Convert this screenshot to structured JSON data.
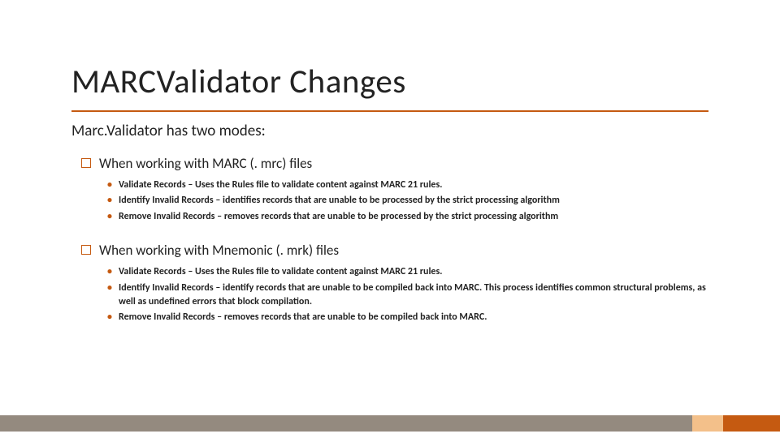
{
  "title": "MARCValidator Changes",
  "lead": "Marc.Validator has two modes:",
  "modes": [
    {
      "title": "When working with MARC (. mrc) files",
      "bullets": [
        "Validate Records – Uses the Rules file to validate content against MARC 21 rules.",
        "Identify Invalid Records – identifies records that are unable to be processed by the strict processing algorithm",
        "Remove Invalid Records – removes records that are unable to be processed by the strict processing algorithm"
      ]
    },
    {
      "title": "When working with Mnemonic (. mrk) files",
      "bullets": [
        "Validate Records – Uses the Rules file to validate content against MARC 21 rules.",
        "Identify Invalid Records – identify records that are unable to be compiled back into MARC.  This process identifies common structural problems, as well as undefined errors that block compilation.",
        "Remove Invalid Records – removes records that are unable to be compiled back into MARC."
      ]
    }
  ]
}
